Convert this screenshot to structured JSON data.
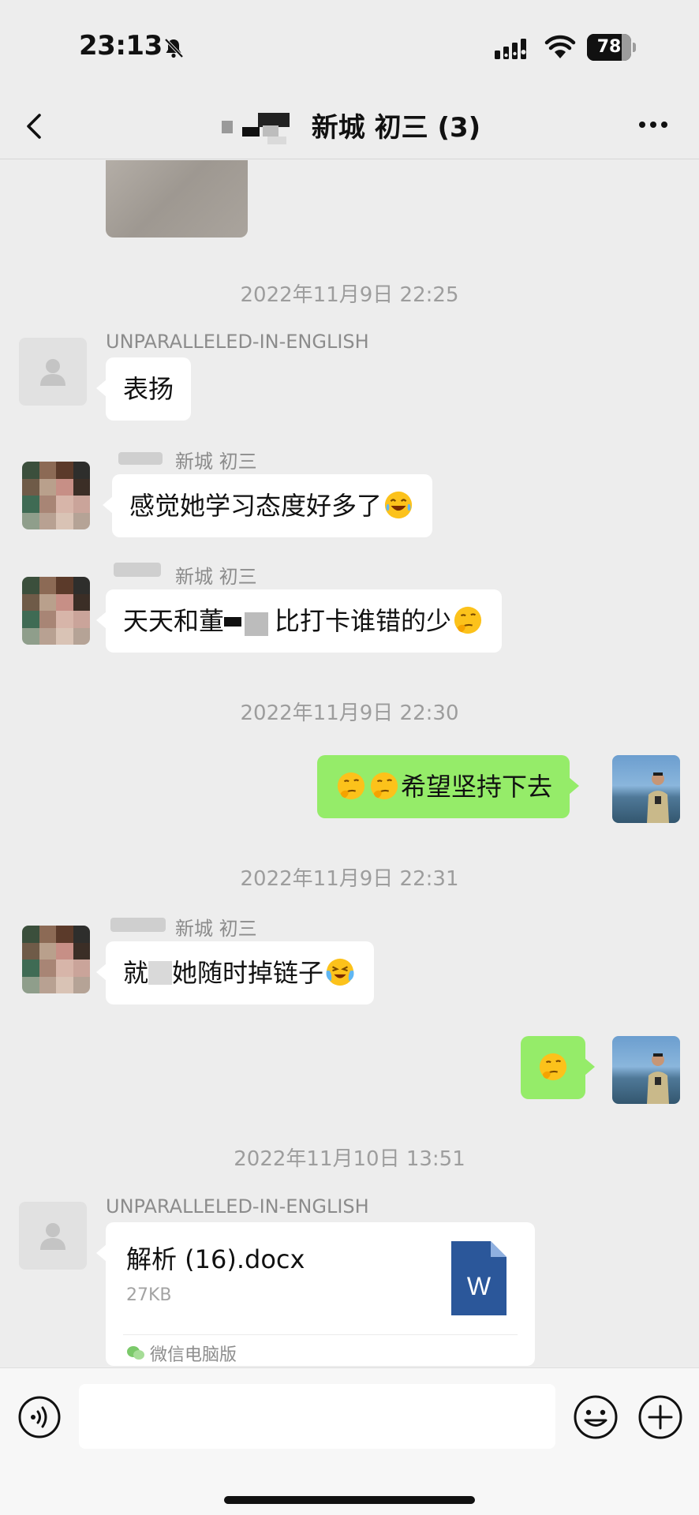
{
  "status_bar": {
    "time": "23:13",
    "battery_percent": "78",
    "battery_level": 0.78
  },
  "nav": {
    "title": "新城  初三 (3)"
  },
  "timestamps": [
    "2022年11月9日 22:25",
    "2022年11月9日 22:30",
    "2022年11月9日 22:31",
    "2022年11月10日 13:51"
  ],
  "messages": [
    {
      "sender": "UNPARALLELED-IN-ENGLISH",
      "text": "表扬"
    },
    {
      "sender": "新城  初三",
      "text": "感觉她学习态度好多了",
      "emoji": "laughing-tears-emoji"
    },
    {
      "sender": "新城  初三",
      "text_before": "天天和董",
      "text_after": "比打卡谁错的少",
      "emoji": "thinking-face-emoji"
    },
    {
      "sender": "self",
      "text": "希望坚持下去",
      "emoji": "thinking-face-emoji"
    },
    {
      "sender": "新城  初三",
      "text_before": "就",
      "text_after": "她随时掉链子",
      "emoji": "crying-laughing-emoji"
    },
    {
      "sender": "self",
      "emoji": "thinking-face-emoji"
    },
    {
      "sender": "UNPARALLELED-IN-ENGLISH",
      "file": {
        "name": "解析 (16).docx",
        "size": "27KB",
        "source": "微信电脑版",
        "icon": "word-doc-icon"
      }
    }
  ],
  "input_bar": {
    "placeholder": ""
  },
  "colors": {
    "background": "#ededed",
    "bubble_self": "#95ec69",
    "bubble_other": "#ffffff",
    "word_blue": "#2b579a"
  }
}
